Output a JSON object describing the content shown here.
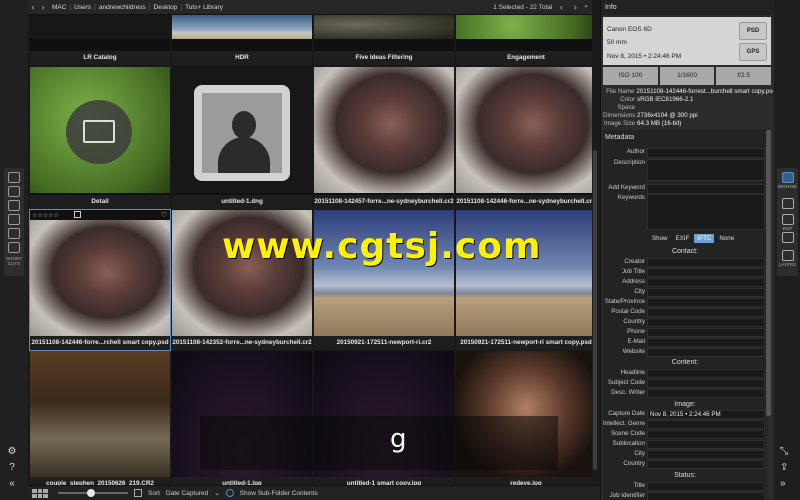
{
  "breadcrumb": [
    "MAC",
    "Users",
    "andrewchildress",
    "Desktop",
    "Tuts+ Library"
  ],
  "selection_status": "1 Selected - 22 Total",
  "left_toolbar": {
    "shortcuts_label": "SHORT CUTS"
  },
  "tiles_row0": [
    {
      "caption": "LR Catalog"
    },
    {
      "caption": "HDR"
    },
    {
      "caption": "Five Ideas Filtering"
    },
    {
      "caption": "Engagement"
    }
  ],
  "tiles_row1": [
    {
      "caption": "Detail"
    },
    {
      "caption": "untitled-1.dng"
    },
    {
      "caption": "20151108-142457-forre...ne-sydneyburchell.cr2"
    },
    {
      "caption": "20151108-142446-forre...ne-sydneyburchell.cr2"
    }
  ],
  "tiles_row2": [
    {
      "caption": "20151108-142446-forre...rchell smart copy.psd",
      "stars": "☆☆☆☆☆"
    },
    {
      "caption": "20151108-142352-forre...ne-sydneyburchell.cr2"
    },
    {
      "caption": "20150921-172511-newport-ri.cr2"
    },
    {
      "caption": "20150921-172511-newport-ri smart copy.psd"
    }
  ],
  "tiles_row3": [
    {
      "caption": "couple_stephen_20150626_219.CR2"
    },
    {
      "caption": "untitled-1.jpg"
    },
    {
      "caption": "untitled-1 smart copy.jpg"
    },
    {
      "caption": "redeye.jpg"
    }
  ],
  "watermark": "www.cgtsj.com",
  "overlay_letter": "g",
  "bottom_bar": {
    "sort_label": "Sort",
    "sort_value": "Date Captured",
    "subfolder_label": "Show Sub-Folder Contents"
  },
  "info": {
    "header": "Info",
    "camera": "Canon EOS 6D",
    "lens": "50 mm",
    "date": "Nov 8, 2015 • 2:24:46 PM",
    "format_badge": "PSD",
    "gps_badge": "GPS",
    "iso": "ISO 100",
    "shutter": "1/1600",
    "aperture": "f/2.5",
    "file_name_label": "File Name",
    "file_name": "20151108-142446-forrest...burchell smart copy.psd",
    "color_space_label": "Color Space",
    "color_space": "sRGB IEC61966-2.1",
    "dimensions_label": "Dimensions",
    "dimensions": "2736x4104 @ 300 ppi",
    "image_size_label": "Image Size",
    "image_size": "64.3 MB (16-bit)"
  },
  "metadata": {
    "header": "Metadata",
    "author_label": "Author",
    "description_label": "Description",
    "add_keyword_label": "Add Keyword",
    "keywords_label": "Keywords",
    "show_label": "Show",
    "tabs": [
      "EXIF",
      "IPTC",
      "None"
    ],
    "contact_header": "Contact:",
    "contact_fields": [
      "Creator",
      "Job Title",
      "Address",
      "City",
      "State/Province",
      "Postal Code",
      "Country",
      "Phone",
      "E-Mail",
      "Website"
    ],
    "content_header": "Content:",
    "content_fields": [
      "Headline",
      "Subject Code",
      "Desc. Writer"
    ],
    "image_header": "Image:",
    "capture_date_label": "Capture Date",
    "capture_date": "Nov 8, 2015 • 2:24:46 PM",
    "image_fields": [
      "Intellect. Genre",
      "Scene Code",
      "Sublocation",
      "City",
      "Country"
    ],
    "status_header": "Status:",
    "status_fields": [
      "Title",
      "Job Identifier"
    ]
  },
  "right_toolbar": [
    "BROWSE",
    "EDIT",
    "LAYERS"
  ]
}
